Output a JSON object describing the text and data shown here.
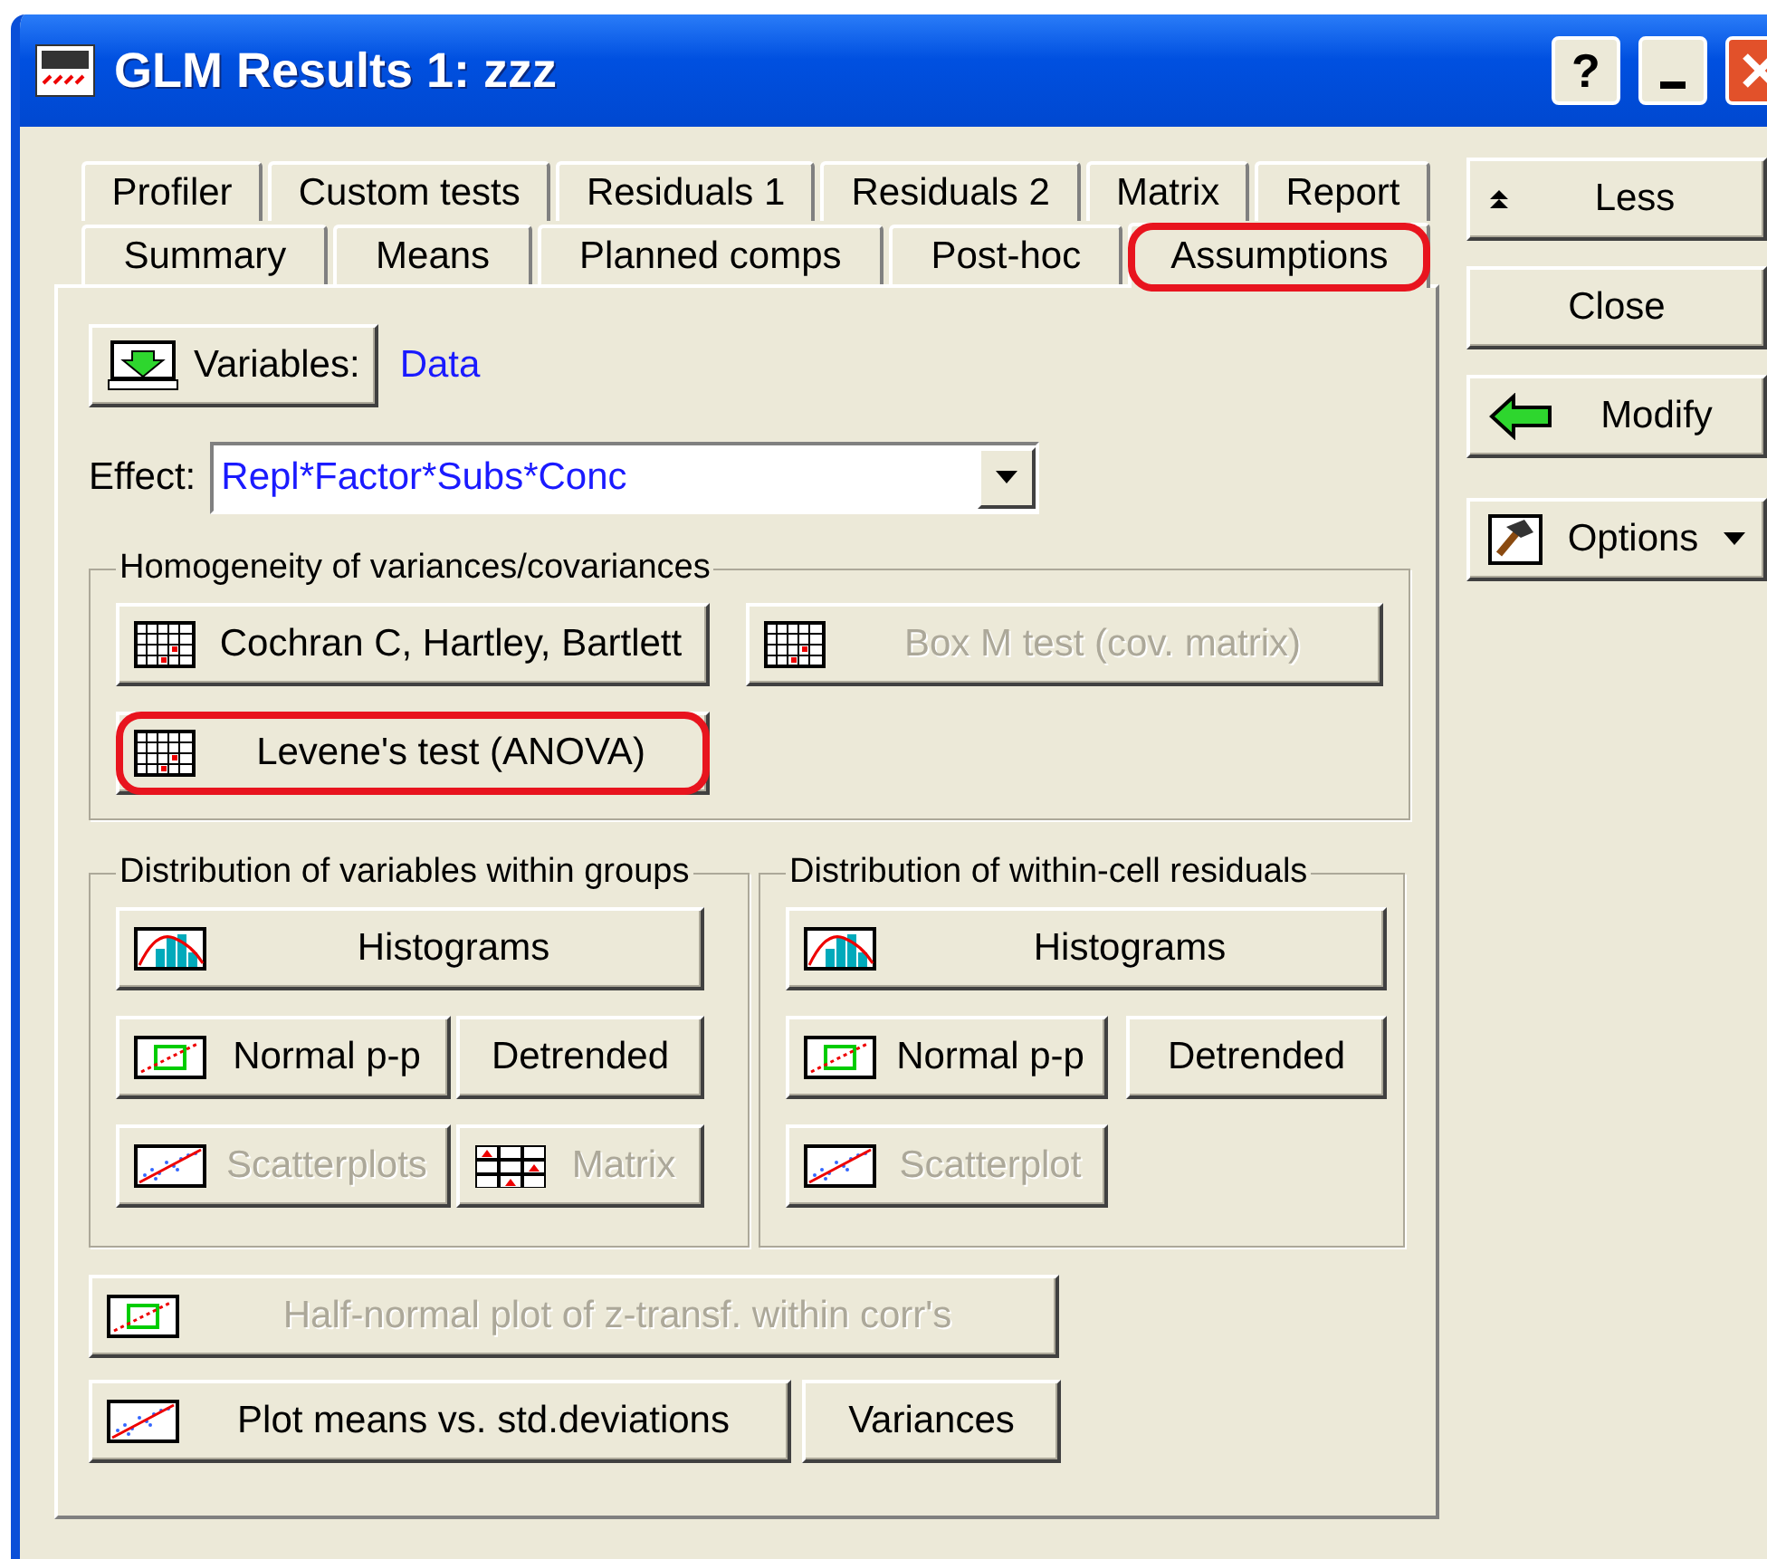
{
  "window": {
    "title": "GLM Results 1: zzz",
    "help_label": "?"
  },
  "tab_rows": [
    [
      {
        "label": "Profiler",
        "selected": false,
        "highlighted": false
      },
      {
        "label": "Custom tests",
        "selected": false,
        "highlighted": false
      },
      {
        "label": "Residuals 1",
        "selected": false,
        "highlighted": false
      },
      {
        "label": "Residuals 2",
        "selected": false,
        "highlighted": false
      },
      {
        "label": "Matrix",
        "selected": false,
        "highlighted": false
      },
      {
        "label": "Report",
        "selected": false,
        "highlighted": false
      }
    ],
    [
      {
        "label": "Summary",
        "selected": false,
        "highlighted": false
      },
      {
        "label": "Means",
        "selected": false,
        "highlighted": false
      },
      {
        "label": "Planned comps",
        "selected": false,
        "highlighted": false
      },
      {
        "label": "Post-hoc",
        "selected": false,
        "highlighted": false
      },
      {
        "label": "Assumptions",
        "selected": true,
        "highlighted": true
      }
    ]
  ],
  "variables": {
    "button": "Variables:",
    "value": "Data"
  },
  "effect": {
    "label": "Effect:",
    "value": "Repl*Factor*Subs*Conc"
  },
  "homogeneity": {
    "title": "Homogeneity of variances/covariances",
    "buttons": [
      {
        "label": "Cochran C, Hartley, Bartlett",
        "kind": "grid",
        "disabled": false,
        "highlighted": false
      },
      {
        "label": "Box M test (cov. matrix)",
        "kind": "grid",
        "disabled": true,
        "highlighted": false
      },
      {
        "label": "Levene's test (ANOVA)",
        "kind": "grid",
        "disabled": false,
        "highlighted": true
      }
    ]
  },
  "distribution_groups": [
    {
      "title": "Distribution of variables within groups",
      "buttons": [
        {
          "label": "Histograms",
          "kind": "histogram",
          "disabled": false
        },
        {
          "label": "Normal p-p",
          "kind": "normal",
          "disabled": false
        },
        {
          "label": "Detrended",
          "kind": "plain",
          "disabled": false
        },
        {
          "label": "Scatterplots",
          "kind": "scatter",
          "disabled": true
        },
        {
          "label": "Matrix",
          "kind": "matrix",
          "disabled": true
        }
      ]
    },
    {
      "title": "Distribution of within-cell residuals",
      "buttons": [
        {
          "label": "Histograms",
          "kind": "histogram",
          "disabled": false
        },
        {
          "label": "Normal p-p",
          "kind": "normal",
          "disabled": false
        },
        {
          "label": "Detrended",
          "kind": "plain",
          "disabled": false
        },
        {
          "label": "Scatterplot",
          "kind": "scatter",
          "disabled": true
        }
      ]
    }
  ],
  "bottom_buttons": [
    {
      "label": "Half-normal plot of z-transf. within corr's",
      "kind": "normal",
      "disabled": true
    },
    {
      "label": "Plot means vs. std.deviations",
      "kind": "scatter",
      "disabled": false
    },
    {
      "label": "Variances",
      "kind": "plain",
      "disabled": false
    }
  ],
  "side_buttons": [
    {
      "label": "Less",
      "kind": "less"
    },
    {
      "label": "Close",
      "kind": "plain"
    },
    {
      "label": "Modify",
      "kind": "modify"
    },
    {
      "label": "Options",
      "kind": "options"
    }
  ]
}
